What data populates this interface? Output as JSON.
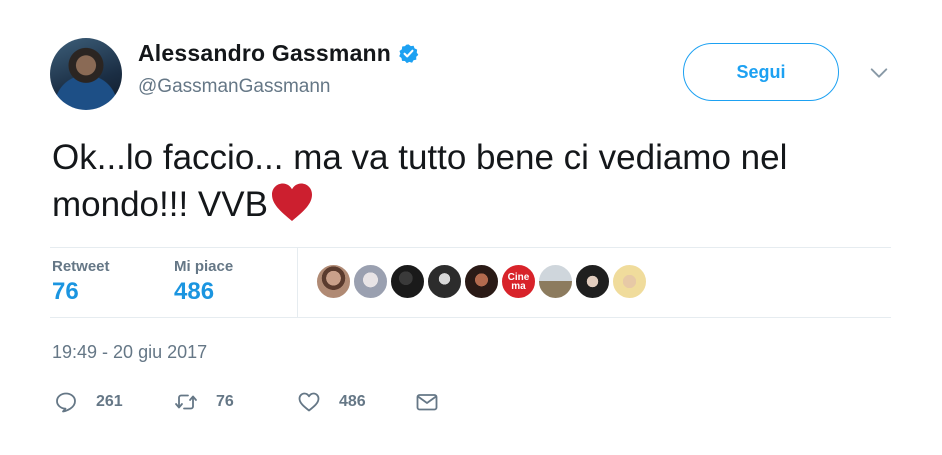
{
  "author": {
    "name": "Alessandro Gassmann",
    "handle": "@GassmanGassmann",
    "verified": true
  },
  "follow_button": {
    "label": "Segui"
  },
  "tweet": {
    "text": "Ok...lo faccio... ma va tutto bene ci vediamo nel mondo!!! VVB",
    "emoji": "red-heart"
  },
  "stats": {
    "retweet_label": "Retweet",
    "retweet_count": "76",
    "likes_label": "Mi piace",
    "likes_count": "486"
  },
  "likers": {
    "count": 9,
    "cinema_avatar_text": "Cine ma"
  },
  "timestamp": "19:49 - 20 giu 2017",
  "actions": {
    "reply_count": "261",
    "retweet_count": "76",
    "like_count": "486"
  },
  "colors": {
    "accent": "#1da1f2",
    "stat_value": "#1b95e0",
    "secondary_text": "#657786",
    "heart": "#e0245e"
  },
  "icons": [
    "verified-badge-icon",
    "chevron-down-icon",
    "reply-icon",
    "retweet-icon",
    "like-icon",
    "direct-message-icon"
  ]
}
